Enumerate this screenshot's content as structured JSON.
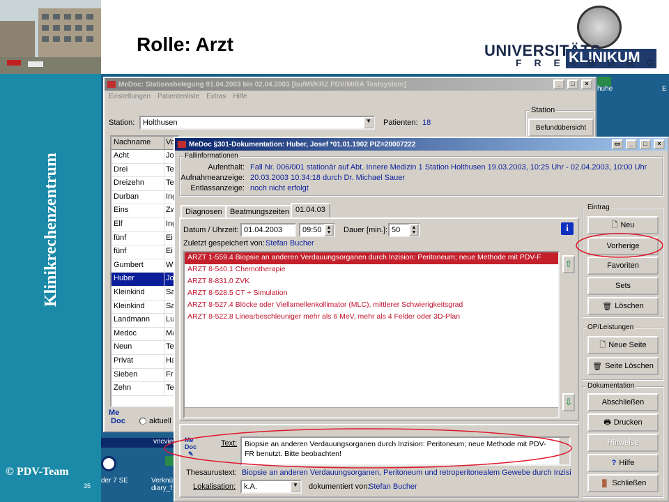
{
  "slide": {
    "title": "Rolle: Arzt",
    "vertical_title": "Klinikrechenzentrum",
    "copyright": "© PDV-Team",
    "slide_number": "35"
  },
  "logo": {
    "universitats": "UNIVERSITÄTS",
    "klinikum": "KLINIKUM",
    "freiburg": "F R E I B U R G"
  },
  "desktop": {
    "icon_label_1": "huhe",
    "icon_label_2": "E",
    "taskbar_1": "vncvie",
    "taskbar_2": "der 7 SE",
    "taskbar_3": "Verknü diary_f"
  },
  "station_window": {
    "title": "MeDoc: Stationsbelegung 01.04.2003 bis 02.04.2003   [bu/MI/KRZ PDV/MIRA Testsystem]",
    "menu": [
      "Einstellungen",
      "Patientenliste",
      "Extras",
      "Hilfe"
    ],
    "station_label": "Station:",
    "station_value": "Holthusen",
    "patients_label": "Patienten:",
    "patients_count": "18",
    "station_group": "Station",
    "befund_button": "Befundübersicht",
    "col_nachname": "Nachname",
    "col_vorname": "Vo",
    "rows": [
      {
        "n": "Acht",
        "v": "Jo"
      },
      {
        "n": "Drei",
        "v": "Te"
      },
      {
        "n": "Dreizehn",
        "v": "Te"
      },
      {
        "n": "Durban",
        "v": "Ing"
      },
      {
        "n": "Eins",
        "v": "Zw"
      },
      {
        "n": "Elf",
        "v": "Ing"
      },
      {
        "n": "fünf",
        "v": "Ei"
      },
      {
        "n": "fünf",
        "v": "Ei"
      },
      {
        "n": "Gumbert",
        "v": "W"
      },
      {
        "n": "Huber",
        "v": "Jo"
      },
      {
        "n": "Kleinkind",
        "v": "Sa"
      },
      {
        "n": "Kleinkind",
        "v": "Sa"
      },
      {
        "n": "Landmann",
        "v": "Lu"
      },
      {
        "n": "Medoc",
        "v": "Ma"
      },
      {
        "n": "Neun",
        "v": "Te"
      },
      {
        "n": "Privat",
        "v": "Ha"
      },
      {
        "n": "Sieben",
        "v": "Fr"
      },
      {
        "n": "Zehn",
        "v": "Te"
      }
    ],
    "radio_label": "aktuell"
  },
  "doc_window": {
    "title": "MeDoc §301-Dokumentation: Huber, Josef *01.01.1902 PIZ=20007222",
    "fallinfo_label": "Fallinformationen",
    "aufenthalt_label": "Aufenthalt:",
    "aufenthalt_value": "Fall Nr. 006/001 stationär auf Abt. Innere Medizin 1 Station Holthusen 19.03.2003, 10:25 Uhr - 02.04.2003, 10:00 Uhr",
    "aufnahme_label": "Aufnahmeanzeige:",
    "aufnahme_value": "20.03.2003 10:34:18 durch Dr. Michael Sauer",
    "entlass_label": "Entlassanzeige:",
    "entlass_value": "noch nicht erfolgt",
    "tabs": [
      "Diagnosen",
      "Beatmungszeiten",
      "01.04.03"
    ],
    "datum_label": "Datum / Uhrzeit:",
    "datum_value": "01.04.2003",
    "uhrzeit_value": "09:50",
    "dauer_label": "Dauer [min.]:",
    "dauer_value": "50",
    "zuletzt_label": "Zuletzt gespeichert von:",
    "zuletzt_value": "Stefan Bucher",
    "entries": [
      "ARZT  1-559.4   Biopsie an anderen Verdauungsorganen durch Inzision: Peritoneum; neue Methode mit PDV-F",
      "ARZT  8-540.1   Chemotherapie",
      "ARZT  8-831.0   ZVK",
      "ARZT  8-528.5   CT + Simulation",
      "ARZT  8-527.4   Blöcke oder Viellamellenkollimator (MLC), mittlerer Schwierigkeitsgrad",
      "ARZT  8-522.8   Linearbeschleuniger mehr als 6 MeV, mehr als 4 Felder oder 3D-Plan"
    ],
    "text_label": "Text:",
    "text_value": "Biopsie an anderen Verdauungsorganen durch Inzision: Peritoneum; neue Methode mit PDV-FR benutzt. Bitte beobachten!",
    "thesaurus_label": "Thesaurustext:",
    "thesaurus_value": "Biopsie an anderen Verdauungsorganen, Peritoneum und retroperitonealem Gewebe durch Inzisi",
    "lokal_label": "Lokalisation:",
    "lokal_value": "k.A.",
    "dokumentiert_label": "dokumentiert von:",
    "dokumentiert_value": "Stefan Bucher",
    "eintrag_group": "Eintrag",
    "btn_neu": "Neu",
    "btn_vorherige": "Vorherige",
    "btn_favoriten": "Favoriten",
    "btn_sets": "Sets",
    "btn_loeschen": "Löschen",
    "op_group": "OP/Leistungen",
    "btn_neue_seite": "Neue Seite",
    "btn_seite_loeschen": "Seite Löschen",
    "dok_group": "Dokumentation",
    "btn_abschliessen": "Abschließen",
    "btn_drucken": "Drucken",
    "btn_hinweise": "Hinweise",
    "btn_hilfe": "Hilfe",
    "btn_schliessen": "Schließen",
    "medoc_logo": "Me Doc"
  },
  "colors": {
    "slide_band": "#1a8aa8",
    "titlebar": "#08246b",
    "selection": "#0a1e9a",
    "entry_red": "#c0142c",
    "highlight_ellipse": "#e0182c"
  }
}
